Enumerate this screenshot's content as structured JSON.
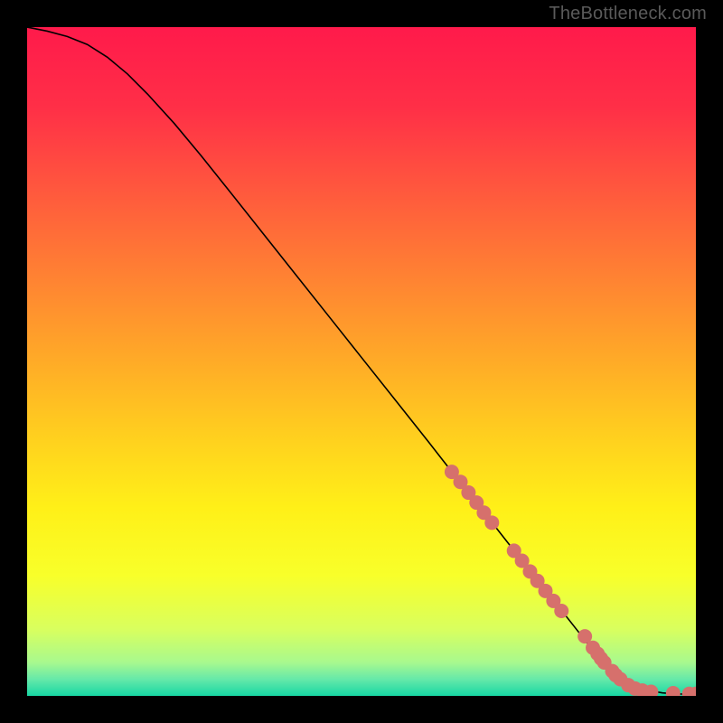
{
  "watermark": "TheBottleneck.com",
  "chart_data": {
    "type": "line",
    "title": "",
    "xlabel": "",
    "ylabel": "",
    "xlim": [
      0,
      100
    ],
    "ylim": [
      0,
      100
    ],
    "axes_visible": false,
    "grid": false,
    "background_gradient": {
      "stops": [
        {
          "offset": 0.0,
          "color": "#ff1a4b"
        },
        {
          "offset": 0.12,
          "color": "#ff2f47"
        },
        {
          "offset": 0.25,
          "color": "#ff5a3d"
        },
        {
          "offset": 0.38,
          "color": "#ff8432"
        },
        {
          "offset": 0.5,
          "color": "#ffab27"
        },
        {
          "offset": 0.62,
          "color": "#ffd21e"
        },
        {
          "offset": 0.72,
          "color": "#fff018"
        },
        {
          "offset": 0.82,
          "color": "#f8ff2a"
        },
        {
          "offset": 0.9,
          "color": "#d9ff5e"
        },
        {
          "offset": 0.95,
          "color": "#a8f98e"
        },
        {
          "offset": 0.975,
          "color": "#66e9a9"
        },
        {
          "offset": 1.0,
          "color": "#17d7a4"
        }
      ]
    },
    "series": [
      {
        "name": "bottleneck-curve",
        "stroke": "#000000",
        "stroke_width": 1.6,
        "x": [
          0,
          3,
          6,
          9,
          12,
          15,
          18,
          22,
          26,
          30,
          35,
          40,
          45,
          50,
          55,
          60,
          65,
          70,
          74,
          78,
          81,
          84,
          86.5,
          89,
          91,
          93,
          95,
          97,
          99,
          100
        ],
        "y": [
          100,
          99.4,
          98.6,
          97.4,
          95.5,
          93.0,
          90.0,
          85.6,
          80.8,
          75.8,
          69.5,
          63.2,
          56.9,
          50.6,
          44.3,
          38.0,
          31.6,
          25.3,
          20.2,
          15.2,
          11.4,
          7.6,
          4.8,
          2.6,
          1.4,
          0.8,
          0.45,
          0.3,
          0.25,
          0.25
        ]
      }
    ],
    "markers": {
      "name": "curve-dots",
      "color": "#d6706c",
      "radius_px": 8,
      "x": [
        63.5,
        64.8,
        66.0,
        67.2,
        68.3,
        69.5,
        72.8,
        74.0,
        75.2,
        76.3,
        77.5,
        78.7,
        79.9,
        83.4,
        84.6,
        85.3,
        85.8,
        86.3,
        87.5,
        88.0,
        88.7,
        89.9,
        90.9,
        92.0,
        93.3,
        96.6,
        99.0,
        100.0
      ],
      "y": [
        33.5,
        32.0,
        30.4,
        28.9,
        27.4,
        25.9,
        21.7,
        20.2,
        18.6,
        17.2,
        15.7,
        14.2,
        12.7,
        8.9,
        7.2,
        6.3,
        5.6,
        5.0,
        3.7,
        3.1,
        2.5,
        1.6,
        1.1,
        0.8,
        0.6,
        0.4,
        0.3,
        0.3
      ]
    }
  }
}
